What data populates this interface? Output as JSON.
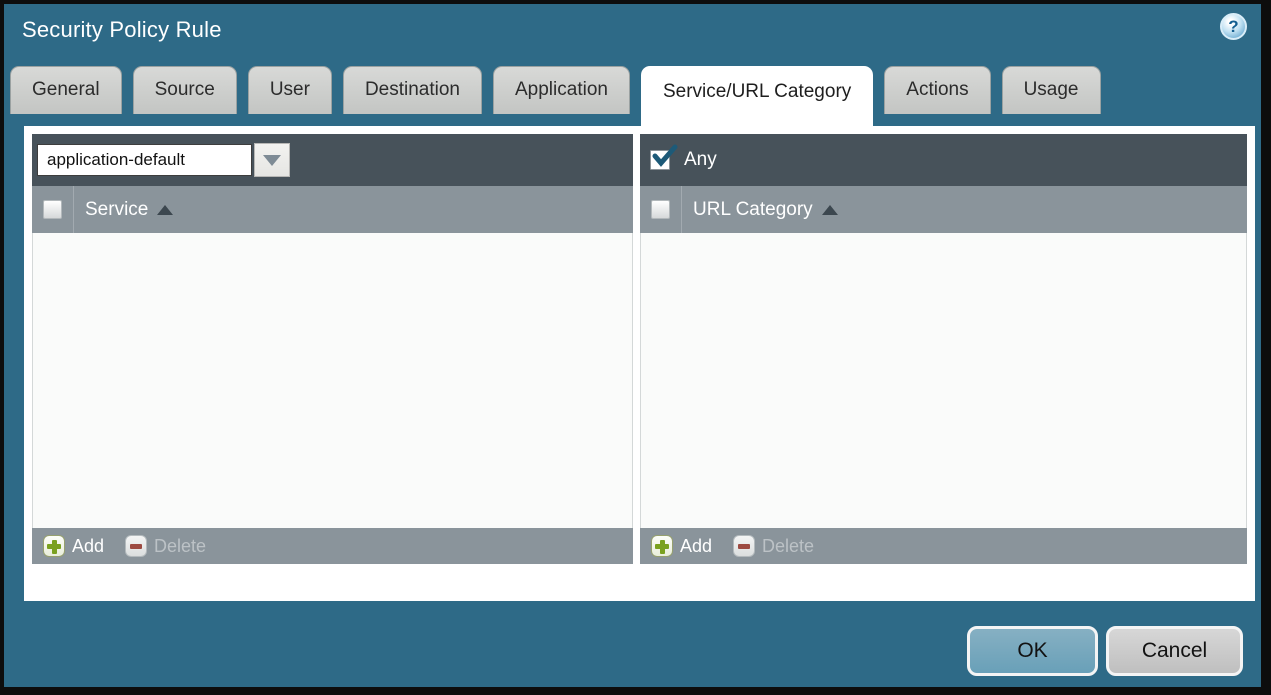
{
  "window": {
    "title": "Security Policy Rule",
    "help_label": "?"
  },
  "tabs": [
    {
      "label": "General",
      "active": false
    },
    {
      "label": "Source",
      "active": false
    },
    {
      "label": "User",
      "active": false
    },
    {
      "label": "Destination",
      "active": false
    },
    {
      "label": "Application",
      "active": false
    },
    {
      "label": "Service/URL Category",
      "active": true
    },
    {
      "label": "Actions",
      "active": false
    },
    {
      "label": "Usage",
      "active": false
    }
  ],
  "service_panel": {
    "service_type_dropdown": {
      "value": "application-default"
    },
    "select_all_checked": false,
    "column_header": "Service",
    "sort": "ascending",
    "rows": [],
    "add_label": "Add",
    "delete_label": "Delete",
    "delete_enabled": false
  },
  "url_category_panel": {
    "any_checkbox": {
      "label": "Any",
      "checked": true
    },
    "select_all_checked": false,
    "column_header": "URL Category",
    "sort": "ascending",
    "rows": [],
    "add_label": "Add",
    "delete_label": "Delete",
    "delete_enabled": false
  },
  "dialog_buttons": {
    "ok": "OK",
    "cancel": "Cancel"
  },
  "colors": {
    "window_bg": "#2e6a87",
    "panel_header_dark": "#47525a",
    "panel_header_gray": "#8a949b",
    "ok_button_bg": "#74a6bc",
    "add_icon_green": "#7aa11f",
    "delete_icon_red": "#9c4a41",
    "checkmark_blue": "#1d5a78"
  }
}
